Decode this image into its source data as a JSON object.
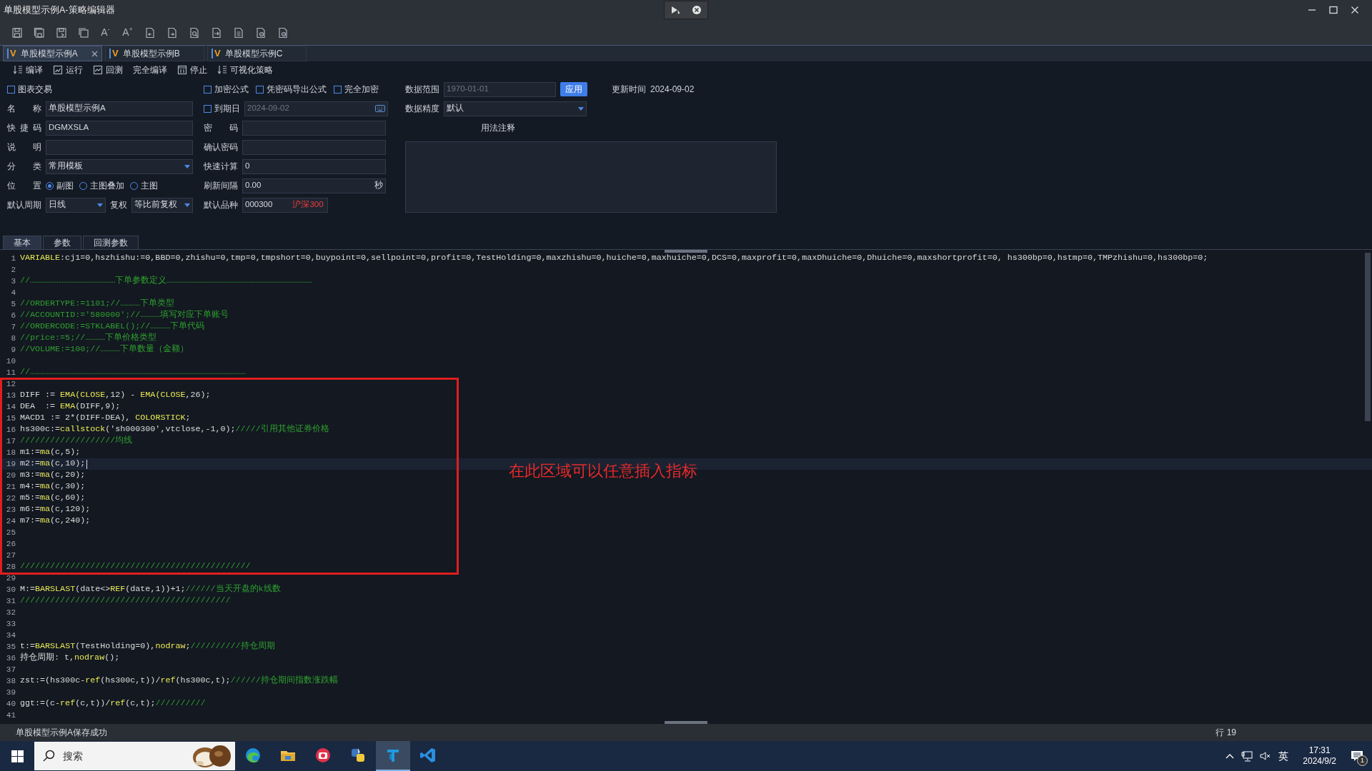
{
  "window": {
    "title": "单股模型示例A-策略编辑器"
  },
  "toolbar": [
    {
      "kind": "save"
    },
    {
      "kind": "save-all"
    },
    {
      "kind": "save-as"
    },
    {
      "kind": "copy"
    },
    {
      "kind": "font",
      "label": "A",
      "sign": "-"
    },
    {
      "kind": "font",
      "label": "A",
      "sign": "+"
    },
    {
      "kind": "file-back"
    },
    {
      "kind": "file-forward"
    },
    {
      "kind": "file-search"
    },
    {
      "kind": "file-import"
    },
    {
      "kind": "file-list"
    },
    {
      "kind": "file-gear"
    },
    {
      "kind": "file-gear"
    }
  ],
  "file_tabs": [
    {
      "icon": "V",
      "label": "单股模型示例A",
      "selected": true,
      "closable": true
    },
    {
      "icon": "V",
      "label": "单股模型示例B",
      "selected": false,
      "closable": false
    },
    {
      "icon": "V",
      "label": "单股模型示例C",
      "selected": false,
      "closable": false
    }
  ],
  "commands": [
    {
      "kind": "compile",
      "label": "编译"
    },
    {
      "kind": "run",
      "label": "运行"
    },
    {
      "kind": "backtest",
      "label": "回测"
    },
    {
      "kind": "plain",
      "label": "完全编译"
    },
    {
      "kind": "stop",
      "label": "停止"
    },
    {
      "kind": "visual",
      "label": "可视化策略"
    }
  ],
  "form": {
    "chart_trading": {
      "label": "图表交易",
      "checked": false
    },
    "name": {
      "label": "名称",
      "value": "单股模型示例A"
    },
    "shortcut": {
      "label": "快捷码",
      "value": "DGMXSLA"
    },
    "description": {
      "label": "说明"
    },
    "category": {
      "label": "分类",
      "value": "常用模板"
    },
    "position": {
      "label": "位置",
      "options": [
        {
          "label": "副图",
          "selected": true
        },
        {
          "label": "主图叠加",
          "selected": false
        },
        {
          "label": "主图",
          "selected": false
        }
      ]
    },
    "period": {
      "label": "默认周期",
      "value": "日线"
    },
    "adjust": {
      "label": "复权",
      "value": "等比前复权"
    },
    "encrypt_options": [
      {
        "label": "加密公式",
        "checked": false
      },
      {
        "label": "凭密码导出公式",
        "checked": false
      },
      {
        "label": "完全加密",
        "checked": false
      }
    ],
    "expiry": {
      "label": "到期日",
      "checked": false,
      "value": "2024-09-02"
    },
    "password": {
      "label": "密码"
    },
    "confirm_password": {
      "label": "确认密码"
    },
    "fast_calc": {
      "label": "快速计算",
      "value": "0"
    },
    "refresh": {
      "label": "刷新间隔",
      "value": "0.00",
      "unit": "秒"
    },
    "default_symbol": {
      "label": "默认品种",
      "value": "000300",
      "name": "沪深300"
    },
    "data_range": {
      "label": "数据范围",
      "value": "1970-01-01",
      "disabled": true,
      "button": "应用"
    },
    "updated": {
      "label": "更新时间",
      "value": "2024-09-02"
    },
    "precision": {
      "label": "数据精度",
      "value": "默认"
    },
    "notes": {
      "label": "用法注释"
    }
  },
  "bottom_tabs": [
    {
      "label": "基本",
      "selected": true
    },
    {
      "label": "参数",
      "selected": false
    },
    {
      "label": "回测参数",
      "selected": false
    }
  ],
  "editor": {
    "annotation": "在此区域可以任意插入指标",
    "lines": [
      {
        "number": "1",
        "selected": false,
        "segments": [
          {
            "kind": "func",
            "text": "VARIABLE"
          },
          {
            "kind": "plain",
            "text": ":cj1=0,hszhishu:=0,BBD=0,zhishu=0,tmp=0,tmpshort=0,buypoint=0,sellpoint=0,profit=0,TestHolding=0,maxzhishu=0,huiche=0,maxhuiche=0,DCS=0,maxprofit=0,maxDhuiche=0,Dhuiche=0,maxshortprofit=0, hs300bp=0,hstmp=0,TMPzhishu=0,hs300bp=0;"
          }
        ]
      },
      {
        "number": "2",
        "selected": false
      },
      {
        "number": "3",
        "selected": false,
        "segments": [
          {
            "kind": "comment",
            "text": "//……………………………………………下单参数定义……………………………………………………………………………"
          }
        ]
      },
      {
        "number": "4",
        "selected": false
      },
      {
        "number": "5",
        "selected": false,
        "segments": [
          {
            "kind": "comment",
            "text": "//ORDERTYPE:=1101;//…………下单类型"
          }
        ]
      },
      {
        "number": "6",
        "selected": false,
        "segments": [
          {
            "kind": "comment",
            "text": "//ACCOUNTID:='580000';//…………填写对应下单账号"
          }
        ]
      },
      {
        "number": "7",
        "selected": false,
        "segments": [
          {
            "kind": "comment",
            "text": "//ORDERCODE:=STKLABEL();//…………下单代码"
          }
        ]
      },
      {
        "number": "8",
        "selected": false,
        "segments": [
          {
            "kind": "comment",
            "text": "//price:=5;//…………下单价格类型"
          }
        ]
      },
      {
        "number": "9",
        "selected": false,
        "segments": [
          {
            "kind": "comment",
            "text": "//VOLUME:=100;//…………下单数量（金额）"
          }
        ]
      },
      {
        "number": "10",
        "selected": false
      },
      {
        "number": "11",
        "selected": false,
        "segments": [
          {
            "kind": "comment",
            "text": "//…………………………………………………………………………………………………………………"
          }
        ]
      },
      {
        "number": "12",
        "selected": false
      },
      {
        "number": "13",
        "selected": false,
        "segments": [
          {
            "kind": "plain",
            "text": "DIFF := "
          },
          {
            "kind": "func",
            "text": "EMA(CLOSE"
          },
          {
            "kind": "plain",
            "text": ",12) - "
          },
          {
            "kind": "func",
            "text": "EMA(CLOSE"
          },
          {
            "kind": "plain",
            "text": ",26);"
          }
        ]
      },
      {
        "number": "14",
        "selected": false,
        "segments": [
          {
            "kind": "plain",
            "text": "DEA  := "
          },
          {
            "kind": "func",
            "text": "EMA"
          },
          {
            "kind": "plain",
            "text": "(DIFF,9);"
          }
        ]
      },
      {
        "number": "15",
        "selected": false,
        "segments": [
          {
            "kind": "plain",
            "text": "MACD1 := 2*(DIFF-DEA), "
          },
          {
            "kind": "func",
            "text": "COLORSTICK"
          },
          {
            "kind": "plain",
            "text": ";"
          }
        ]
      },
      {
        "number": "16",
        "selected": false,
        "segments": [
          {
            "kind": "plain",
            "text": "hs300c:="
          },
          {
            "kind": "func",
            "text": "callstock"
          },
          {
            "kind": "plain",
            "text": "('sh000300',vtclose,-1,0);"
          },
          {
            "kind": "comment",
            "text": "/////引用其他证券价格"
          }
        ]
      },
      {
        "number": "17",
        "selected": false,
        "segments": [
          {
            "kind": "comment",
            "text": "///////////////////均线"
          }
        ]
      },
      {
        "number": "18",
        "selected": false,
        "segments": [
          {
            "kind": "plain",
            "text": "m1:="
          },
          {
            "kind": "func",
            "text": "ma"
          },
          {
            "kind": "plain",
            "text": "(c,5);"
          }
        ]
      },
      {
        "number": "19",
        "selected": true,
        "segments": [
          {
            "kind": "plain",
            "text": "m2:="
          },
          {
            "kind": "func",
            "text": "ma"
          },
          {
            "kind": "plain",
            "text": "(c,10);"
          }
        ]
      },
      {
        "number": "20",
        "selected": false,
        "segments": [
          {
            "kind": "plain",
            "text": "m3:="
          },
          {
            "kind": "func",
            "text": "ma"
          },
          {
            "kind": "plain",
            "text": "(c,20);"
          }
        ]
      },
      {
        "number": "21",
        "selected": false,
        "segments": [
          {
            "kind": "plain",
            "text": "m4:="
          },
          {
            "kind": "func",
            "text": "ma"
          },
          {
            "kind": "plain",
            "text": "(c,30);"
          }
        ]
      },
      {
        "number": "22",
        "selected": false,
        "segments": [
          {
            "kind": "plain",
            "text": "m5:="
          },
          {
            "kind": "func",
            "text": "ma"
          },
          {
            "kind": "plain",
            "text": "(c,60);"
          }
        ]
      },
      {
        "number": "23",
        "selected": false,
        "segments": [
          {
            "kind": "plain",
            "text": "m6:="
          },
          {
            "kind": "func",
            "text": "ma"
          },
          {
            "kind": "plain",
            "text": "(c,120);"
          }
        ]
      },
      {
        "number": "24",
        "selected": false,
        "segments": [
          {
            "kind": "plain",
            "text": "m7:="
          },
          {
            "kind": "func",
            "text": "ma"
          },
          {
            "kind": "plain",
            "text": "(c,240);"
          }
        ]
      },
      {
        "number": "25",
        "selected": false
      },
      {
        "number": "26",
        "selected": false
      },
      {
        "number": "27",
        "selected": false
      },
      {
        "number": "28",
        "selected": false,
        "segments": [
          {
            "kind": "comment",
            "text": "//////////////////////////////////////////////"
          }
        ]
      },
      {
        "number": "29",
        "selected": false
      },
      {
        "number": "30",
        "selected": false,
        "segments": [
          {
            "kind": "plain",
            "text": "M:="
          },
          {
            "kind": "func",
            "text": "BARSLAST"
          },
          {
            "kind": "plain",
            "text": "(date<>"
          },
          {
            "kind": "func",
            "text": "REF"
          },
          {
            "kind": "plain",
            "text": "(date,1))+1;"
          },
          {
            "kind": "comment",
            "text": "//////当天开盘的k线数"
          }
        ]
      },
      {
        "number": "31",
        "selected": false,
        "segments": [
          {
            "kind": "comment",
            "text": "//////////////////////////////////////////"
          }
        ]
      },
      {
        "number": "32",
        "selected": false
      },
      {
        "number": "33",
        "selected": false
      },
      {
        "number": "34",
        "selected": false
      },
      {
        "number": "35",
        "selected": false,
        "segments": [
          {
            "kind": "plain",
            "text": "t:="
          },
          {
            "kind": "func",
            "text": "BARSLAST"
          },
          {
            "kind": "plain",
            "text": "(TestHolding=0),"
          },
          {
            "kind": "func",
            "text": "nodraw"
          },
          {
            "kind": "plain",
            "text": ";"
          },
          {
            "kind": "comment",
            "text": "//////////持仓周期"
          }
        ]
      },
      {
        "number": "36",
        "selected": false,
        "segments": [
          {
            "kind": "plain",
            "text": "持仓周期: t,"
          },
          {
            "kind": "func",
            "text": "nodraw"
          },
          {
            "kind": "plain",
            "text": "();"
          }
        ]
      },
      {
        "number": "37",
        "selected": false
      },
      {
        "number": "38",
        "selected": false,
        "segments": [
          {
            "kind": "plain",
            "text": "zst:=(hs300c-"
          },
          {
            "kind": "func",
            "text": "ref"
          },
          {
            "kind": "plain",
            "text": "(hs300c,t))/"
          },
          {
            "kind": "func",
            "text": "ref"
          },
          {
            "kind": "plain",
            "text": "(hs300c,t);"
          },
          {
            "kind": "comment",
            "text": "//////持仓期间指数涨跌幅"
          }
        ]
      },
      {
        "number": "39",
        "selected": false
      },
      {
        "number": "40",
        "selected": false,
        "segments": [
          {
            "kind": "plain",
            "text": "ggt:=(c-"
          },
          {
            "kind": "func",
            "text": "ref"
          },
          {
            "kind": "plain",
            "text": "(c,t))/"
          },
          {
            "kind": "func",
            "text": "ref"
          },
          {
            "kind": "plain",
            "text": "(c,t);"
          },
          {
            "kind": "comment",
            "text": "//////////"
          }
        ]
      },
      {
        "number": "41",
        "selected": false
      }
    ]
  },
  "status_bar": {
    "message": "单股模型示例A保存成功",
    "line": "行 19"
  },
  "taskbar": {
    "search": {
      "placeholder": "搜索"
    },
    "apps": [
      {
        "kind": "browser",
        "selected": false
      },
      {
        "kind": "folder",
        "selected": false
      },
      {
        "kind": "camera",
        "selected": false
      },
      {
        "kind": "python",
        "selected": false
      },
      {
        "kind": "trader",
        "selected": true
      },
      {
        "kind": "code",
        "selected": false
      }
    ],
    "tray": {
      "language": "英",
      "time": "17:31",
      "date": "2024/9/2",
      "notifications": "1"
    }
  }
}
